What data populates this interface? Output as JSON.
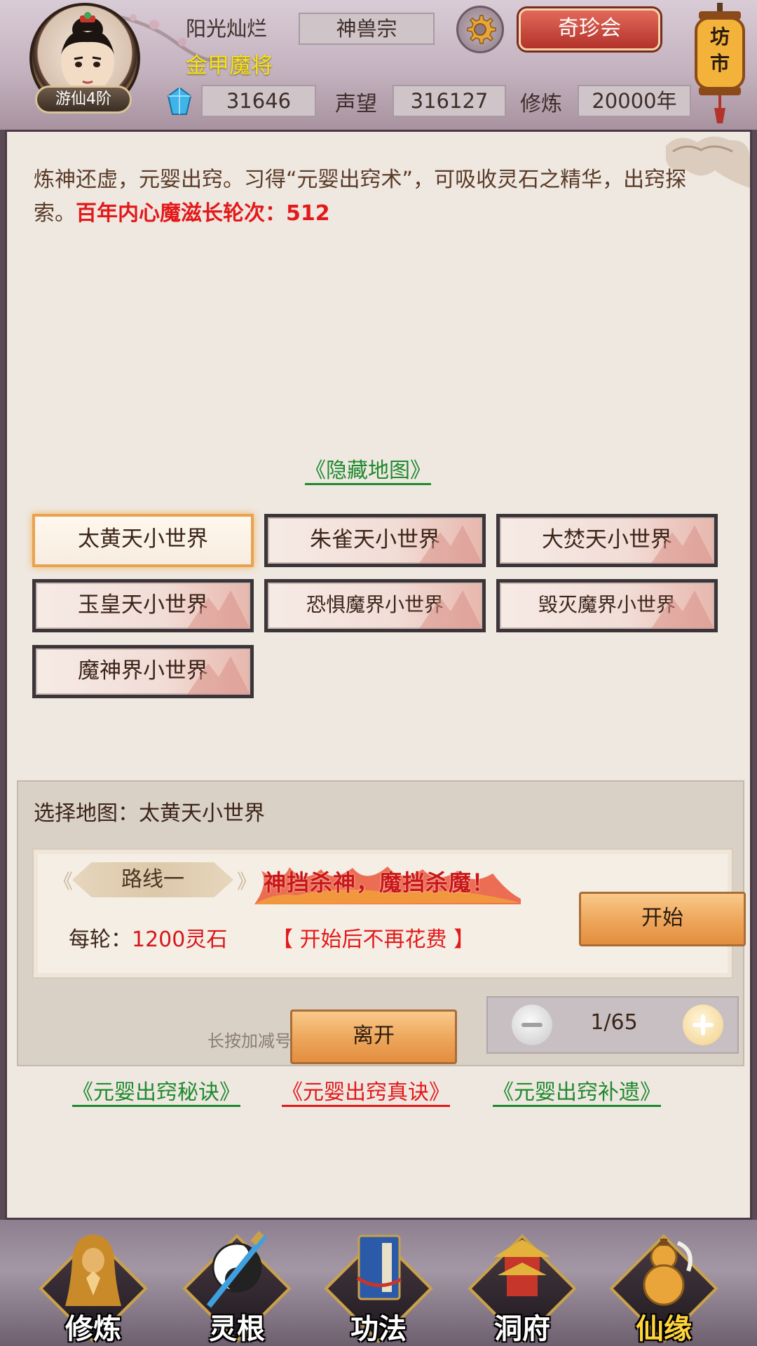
{
  "header": {
    "player_name": "阳光灿烂",
    "player_title": "金甲魔将",
    "rank_badge": "游仙4阶",
    "sect": "神兽宗",
    "treasure_button": "奇珍会",
    "market_lantern": "坊市",
    "spirit_crystals": "31646",
    "reputation_label": "声望",
    "reputation_value": "316127",
    "cultivation_label": "修炼",
    "cultivation_value": "20000年"
  },
  "description": {
    "text": "炼神还虚，元婴出窍。习得“元婴出窍术”，可吸收灵石之精华，出窍探索。",
    "highlight": "百年内心魔滋长轮次：512"
  },
  "hidden_map_link": "《隐藏地图》",
  "maps": [
    {
      "label": "太黄天小世界",
      "selected": true
    },
    {
      "label": "朱雀天小世界",
      "selected": false
    },
    {
      "label": "大焚天小世界",
      "selected": false
    },
    {
      "label": "玉皇天小世界",
      "selected": false
    },
    {
      "label": "恐惧魔界小世界",
      "selected": false
    },
    {
      "label": "毁灭魔界小世界",
      "selected": false
    },
    {
      "label": "魔神界小世界",
      "selected": false
    }
  ],
  "selection": {
    "label": "选择地图：太黄天小世界",
    "route_name": "路线一",
    "slogan": "神挡杀神，魔挡杀魔！",
    "per_round_label": "每轮：",
    "per_round_cost": "1200灵石",
    "no_fee_note": "【 开始后不再花费 】",
    "start_button": "开始",
    "hint": "长按加减号可以快速调整数量",
    "quantity": "1/65"
  },
  "guide_links": [
    {
      "label": "《元婴出窍秘诀》",
      "color": "green"
    },
    {
      "label": "《元婴出窍真诀》",
      "color": "red"
    },
    {
      "label": "《元婴出窍补遗》",
      "color": "green"
    }
  ],
  "leave_button": "离开",
  "bottom_nav": [
    {
      "label": "修炼",
      "icon": "meditating-monk-icon",
      "active": false
    },
    {
      "label": "灵根",
      "icon": "yin-yang-sword-icon",
      "active": false
    },
    {
      "label": "功法",
      "icon": "scripture-book-icon",
      "active": false
    },
    {
      "label": "洞府",
      "icon": "pagoda-icon",
      "active": false
    },
    {
      "label": "仙缘",
      "icon": "gourd-icon",
      "active": true
    }
  ],
  "colors": {
    "highlight_red": "#e3191a",
    "link_green": "#1f8a2d",
    "title_yellow": "#f5e21a",
    "button_orange": "#eda55a"
  }
}
